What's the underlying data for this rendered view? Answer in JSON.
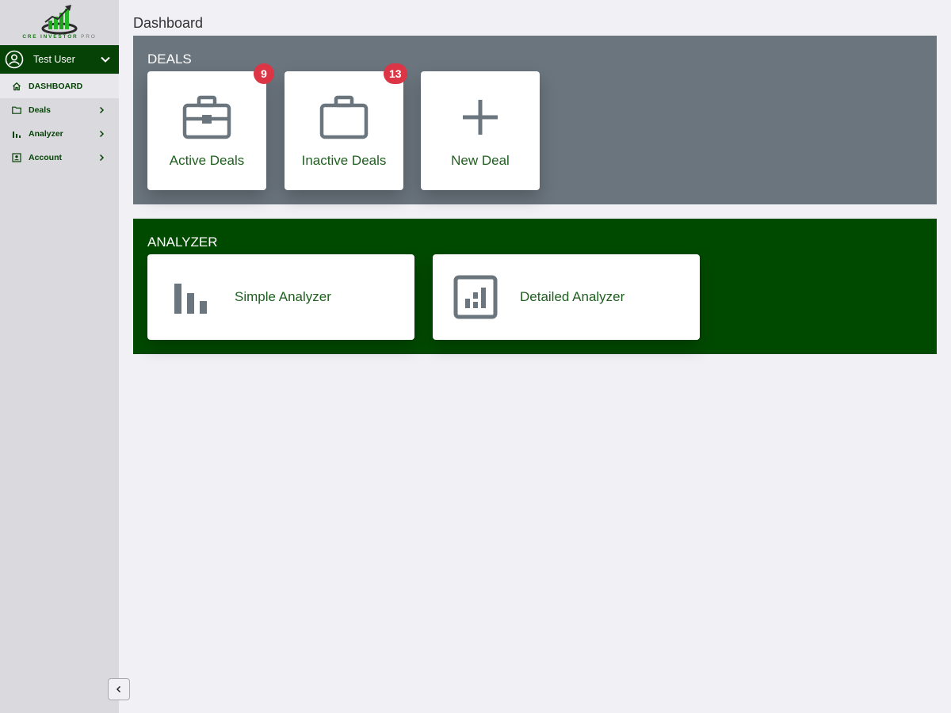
{
  "brand": {
    "name": "CRE INVESTOR",
    "suffix": "PRO"
  },
  "user": {
    "name": "Test User"
  },
  "nav": {
    "items": [
      {
        "label": "DASHBOARD",
        "icon": "home-icon",
        "active": true
      },
      {
        "label": "Deals",
        "icon": "folder-icon"
      },
      {
        "label": "Analyzer",
        "icon": "bar-chart-icon"
      },
      {
        "label": "Account",
        "icon": "account-box-icon"
      }
    ]
  },
  "page": {
    "title": "Dashboard"
  },
  "deals": {
    "title": "DEALS",
    "cards": [
      {
        "label": "Active Deals",
        "icon": "briefcase-icon",
        "badge": "9"
      },
      {
        "label": "Inactive Deals",
        "icon": "suitcase-icon",
        "badge": "13"
      },
      {
        "label": "New Deal",
        "icon": "plus-icon"
      }
    ]
  },
  "analyzer": {
    "title": "ANALYZER",
    "cards": [
      {
        "label": "Simple Analyzer",
        "icon": "bar-chart-icon"
      },
      {
        "label": "Detailed Analyzer",
        "icon": "analytics-icon"
      }
    ]
  },
  "colors": {
    "sidebar_bg": "#dadade",
    "user_bar_bg": "#064206",
    "deals_bg": "#6b757e",
    "analyzer_bg": "#004a00",
    "badge": "#dc3545",
    "card_text": "#1f5f1f",
    "icon_gray": "#6b757e"
  }
}
